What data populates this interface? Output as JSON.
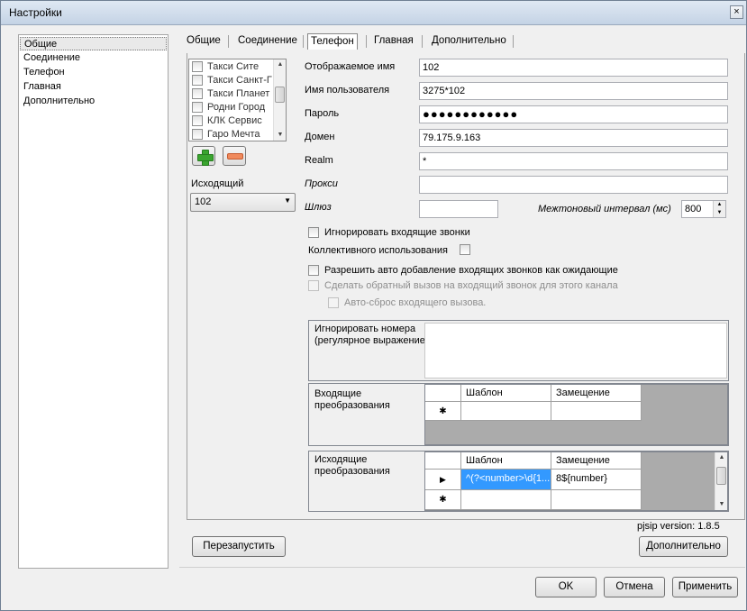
{
  "window": {
    "title": "Настройки",
    "close": "×"
  },
  "nav": {
    "items": [
      "Общие",
      "Соединение",
      "Телефон",
      "Главная",
      "Дополнительно"
    ],
    "selected": 0
  },
  "tabs": {
    "items": [
      "Общие",
      "Соединение",
      "Телефон",
      "Главная",
      "Дополнительно"
    ],
    "active": 2
  },
  "accounts": {
    "items": [
      "Такси Сите",
      "Такси Санкт-Г",
      "Такси Планет",
      "Родни Город",
      "КЛК Сервис",
      "Гаро Мечта"
    ]
  },
  "outgoing": {
    "label": "Исходящий",
    "value": "102"
  },
  "form": {
    "display_name_label": "Отображаемое имя",
    "display_name": "102",
    "username_label": "Имя пользователя",
    "username": "3275*102",
    "password_label": "Пароль",
    "password": "●●●●●●●●●●●●",
    "domain_label": "Домен",
    "domain": "79.175.9.163",
    "realm_label": "Realm",
    "realm": "*",
    "proxy_label": "Прокси",
    "proxy": "",
    "gateway_label": "Шлюз",
    "gateway": "",
    "tone_interval_label": "Межтоновый интервал (мс)",
    "tone_interval": "800"
  },
  "options": {
    "ignore_incoming": "Игнорировать входящие звонки",
    "shared_use": "Коллективного использования",
    "auto_add_waiting": "Разрешить авто добавление входящих звонков как ожидающие",
    "callback": "Сделать обратный вызов на входящий звонок для этого канала",
    "auto_reset": "Авто-сброс входящего вызова."
  },
  "ignore_numbers": {
    "label": "Игнорировать номера (регулярное выражение"
  },
  "incoming_transform": {
    "label": "Входящие преобразования",
    "col_pattern": "Шаблон",
    "col_replace": "Замещение",
    "new_row_marker": "✱"
  },
  "outgoing_transform": {
    "label": "Исходящие преобразования",
    "col_pattern": "Шаблон",
    "col_replace": "Замещение",
    "rows": [
      {
        "marker": "▶",
        "pattern": "^(?<number>\\d{1...",
        "replace": "8${number}"
      }
    ],
    "new_row_marker": "✱"
  },
  "version": "pjsip version: 1.8.5",
  "buttons": {
    "restart": "Перезапустить",
    "advanced": "Дополнительно",
    "ok": "OK",
    "cancel": "Отмена",
    "apply": "Применить"
  }
}
